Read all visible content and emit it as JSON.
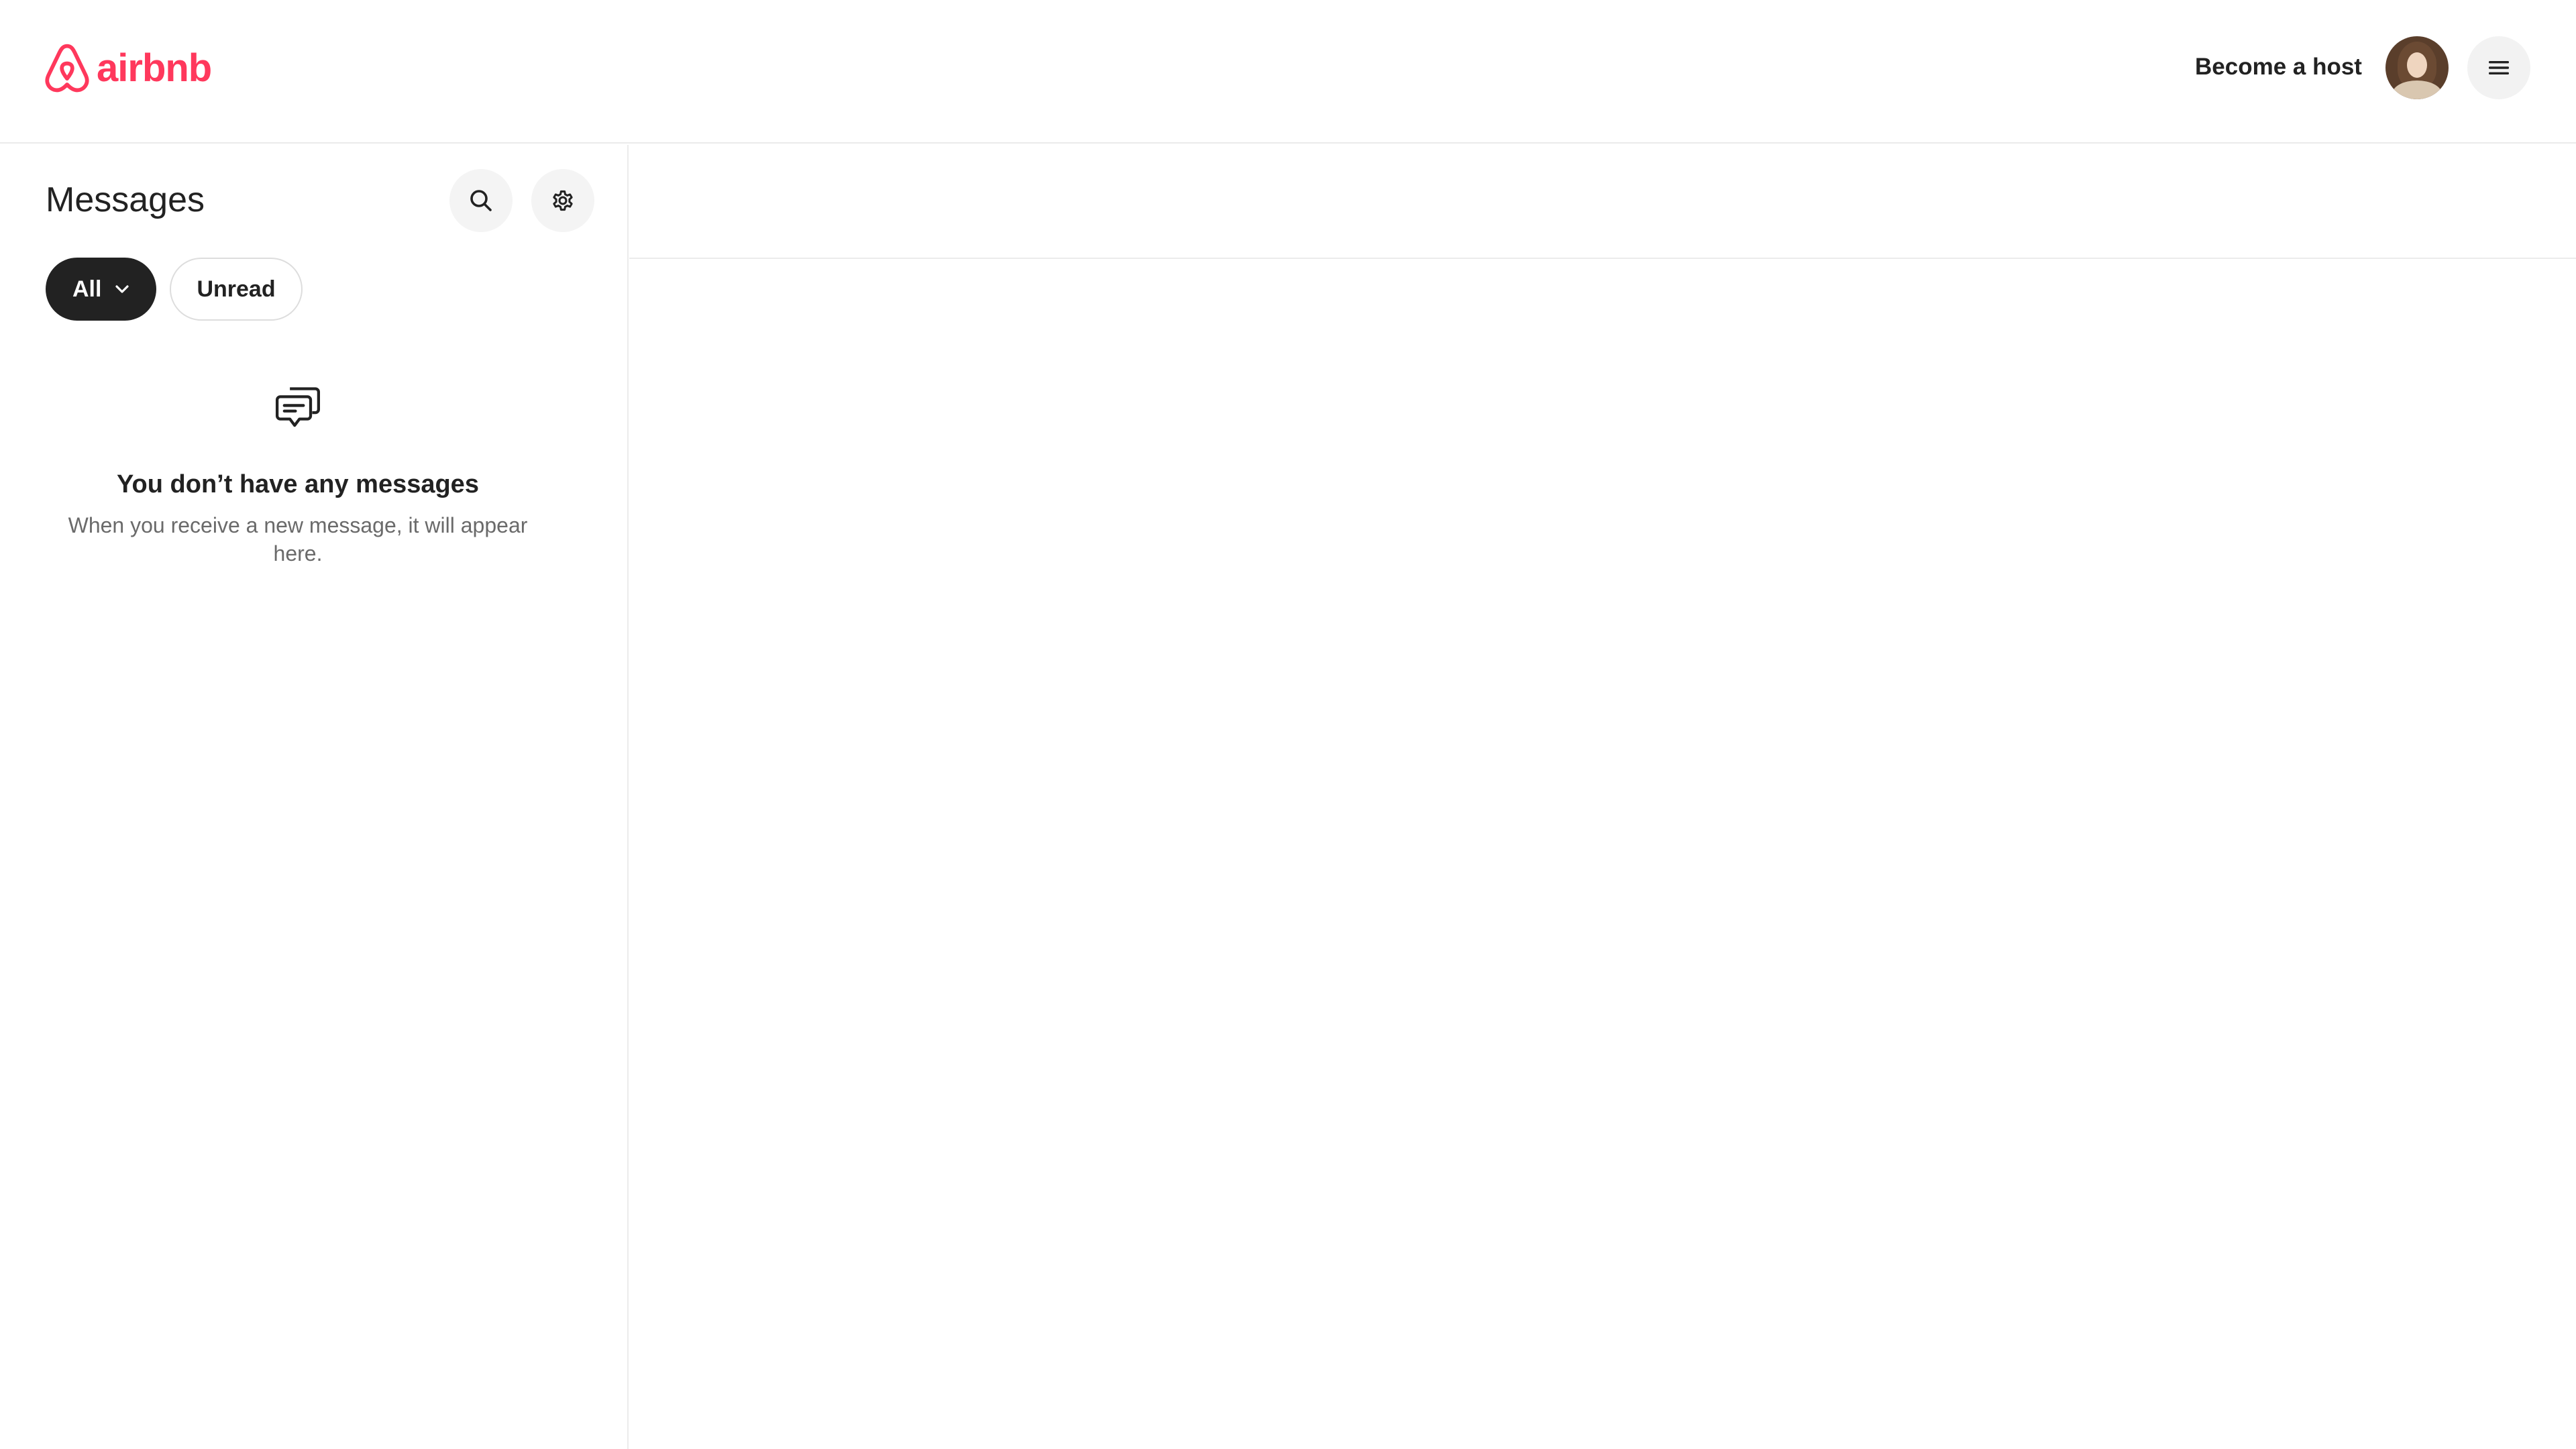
{
  "header": {
    "logo_text": "airbnb",
    "become_host_label": "Become a host",
    "brand_color": "#ff385c",
    "icons": {
      "logo": "airbnb-belo-icon",
      "avatar": "user-avatar",
      "menu": "hamburger-menu-icon"
    }
  },
  "sidebar": {
    "title": "Messages",
    "icons": {
      "search": "search-icon",
      "settings": "gear-icon"
    },
    "filters": [
      {
        "label": "All",
        "selected": true,
        "icon": "chevron-down-icon"
      },
      {
        "label": "Unread",
        "selected": false
      }
    ],
    "empty_state": {
      "icon": "chat-bubbles-icon",
      "title": "You don’t have any messages",
      "description": "When you receive a new message, it will appear here."
    }
  }
}
